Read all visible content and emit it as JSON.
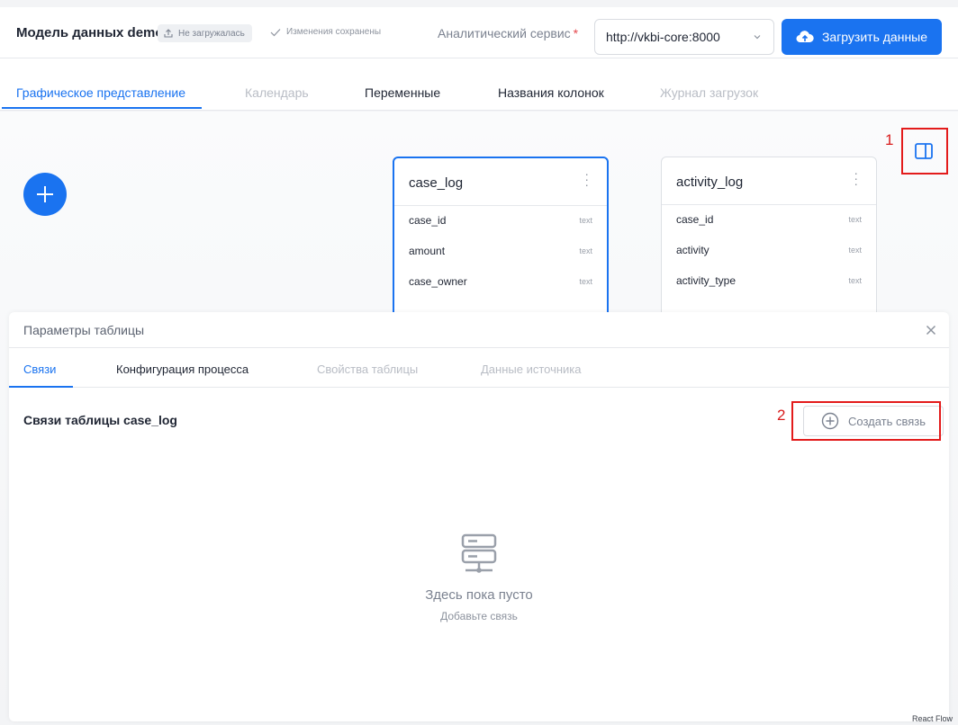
{
  "header": {
    "model_title": "Модель данных demo",
    "status_badge": "Не загружалась",
    "saved_status": "Изменения сохранены",
    "service_label": "Аналитический сервис",
    "service_required": "*",
    "service_value": "http://vkbi-core:8000",
    "upload_button": "Загрузить данные"
  },
  "main_tabs": [
    {
      "label": "Графическое представление",
      "state": "active"
    },
    {
      "label": "Календарь",
      "state": "disabled"
    },
    {
      "label": "Переменные",
      "state": "normal"
    },
    {
      "label": "Названия колонок",
      "state": "normal"
    },
    {
      "label": "Журнал загрузок",
      "state": "disabled"
    }
  ],
  "annotations": {
    "first": "1",
    "second": "2"
  },
  "nodes": [
    {
      "name": "case_log",
      "selected": true,
      "columns": [
        {
          "name": "case_id",
          "type": "text"
        },
        {
          "name": "amount",
          "type": "text"
        },
        {
          "name": "case_owner",
          "type": "text"
        }
      ]
    },
    {
      "name": "activity_log",
      "selected": false,
      "columns": [
        {
          "name": "case_id",
          "type": "text"
        },
        {
          "name": "activity",
          "type": "text"
        },
        {
          "name": "activity_type",
          "type": "text"
        }
      ]
    }
  ],
  "panel": {
    "title": "Параметры таблицы",
    "tabs": [
      {
        "label": "Связи",
        "state": "active"
      },
      {
        "label": "Конфигурация процесса",
        "state": "normal"
      },
      {
        "label": "Свойства таблицы",
        "state": "disabled"
      },
      {
        "label": "Данные источника",
        "state": "disabled"
      }
    ],
    "relations_title": "Связи таблицы case_log",
    "create_button": "Создать связь",
    "empty_title": "Здесь пока пусто",
    "empty_subtitle": "Добавьте связь"
  },
  "attribution": "React Flow",
  "colors": {
    "accent": "#1a73f0",
    "annotation": "#e31b1b"
  }
}
